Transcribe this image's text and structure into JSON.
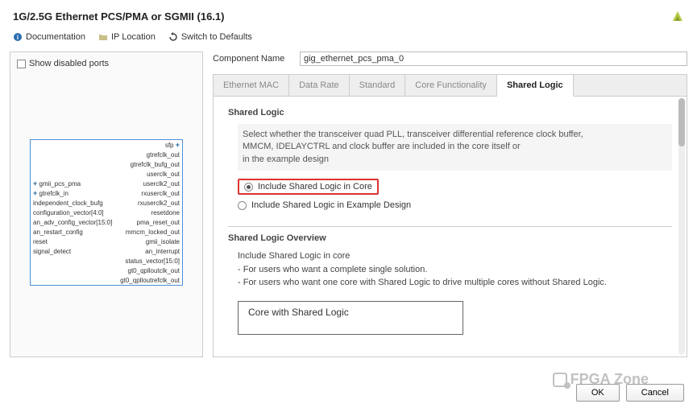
{
  "header": {
    "title": "1G/2.5G Ethernet PCS/PMA or SGMII (16.1)"
  },
  "toolbar": {
    "doc": "Documentation",
    "loc": "IP Location",
    "reset": "Switch to Defaults"
  },
  "leftPanel": {
    "showDisabled": "Show disabled ports",
    "portsLeft": [
      "gmii_pcs_pma",
      "gtrefclk_in",
      "independent_clock_bufg",
      "configuration_vector[4:0]",
      "an_adv_config_vector[15:0]",
      "an_restart_config",
      "reset",
      "signal_detect"
    ],
    "portsRight": [
      "sfp",
      "gtrefclk_out",
      "gtrefclk_bufg_out",
      "userclk_out",
      "userclk2_out",
      "rxuserclk_out",
      "rxuserclk2_out",
      "resetdone",
      "pma_reset_out",
      "mmcm_locked_out",
      "gmii_isolate",
      "an_interrupt",
      "status_vector[15:0]",
      "gt0_qplloutclk_out",
      "gt0_qplloutrefclk_out"
    ]
  },
  "rightPanel": {
    "compNameLabel": "Component Name",
    "compName": "gig_ethernet_pcs_pma_0",
    "tabs": [
      "Ethernet MAC",
      "Data Rate",
      "Standard",
      "Core Functionality",
      "Shared Logic"
    ],
    "activeTab": 4,
    "sharedLogic": {
      "title": "Shared Logic",
      "desc1": "Select whether the transceiver quad PLL, transceiver differential reference clock buffer,",
      "desc2": "MMCM, IDELAYCTRL and clock buffer are included in the core itself or",
      "desc3": "in the example design",
      "opt1": "Include Shared Logic in Core",
      "opt2": "Include Shared Logic in Example Design"
    },
    "overview": {
      "title": "Shared Logic Overview",
      "line1": "Include Shared Logic in core",
      "line2": "- For users who want a complete single solution.",
      "line3": "- For users who want one core with Shared Logic to drive multiple cores without Shared Logic.",
      "boxTitle": "Core with Shared Logic"
    }
  },
  "footer": {
    "ok": "OK",
    "cancel": "Cancel"
  },
  "watermark": "FPGA Zone"
}
